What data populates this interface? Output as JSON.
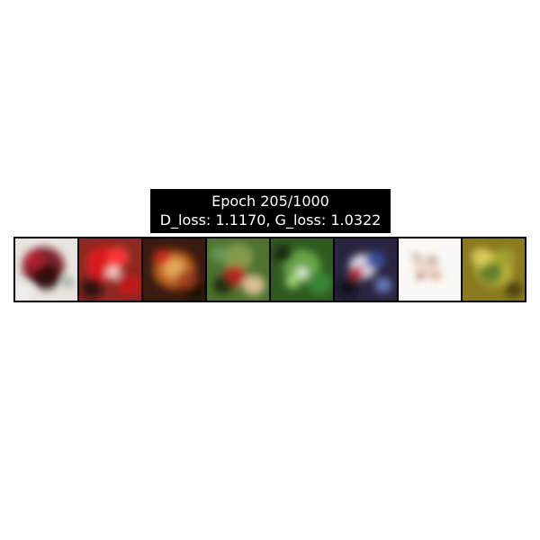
{
  "figure": {
    "title_line1": "Epoch 205/1000",
    "title_line2": "D_loss: 1.1170, G_loss: 1.0322"
  },
  "samples": [
    {
      "name": "sample-1",
      "bg": "#e9e4df",
      "blobs": [
        [
          "#6e0f1a",
          0.45,
          0.45,
          0.34
        ],
        [
          "#2a0a0c",
          0.5,
          0.62,
          0.22
        ],
        [
          "#b21e2e",
          0.3,
          0.35,
          0.16
        ],
        [
          "#f2f2f2",
          0.12,
          0.85,
          0.14
        ],
        [
          "#a0b0a0",
          0.85,
          0.7,
          0.1
        ]
      ]
    },
    {
      "name": "sample-2",
      "bg": "#8b2a22",
      "blobs": [
        [
          "#e0181c",
          0.4,
          0.4,
          0.3
        ],
        [
          "#ff3a3a",
          0.62,
          0.3,
          0.18
        ],
        [
          "#f4d6d0",
          0.55,
          0.55,
          0.12
        ],
        [
          "#2a0808",
          0.2,
          0.8,
          0.18
        ],
        [
          "#c21818",
          0.8,
          0.75,
          0.2
        ]
      ]
    },
    {
      "name": "sample-3",
      "bg": "#3b1a10",
      "blobs": [
        [
          "#c8641e",
          0.5,
          0.5,
          0.34
        ],
        [
          "#e8b060",
          0.5,
          0.48,
          0.18
        ],
        [
          "#d02a1c",
          0.3,
          0.3,
          0.14
        ],
        [
          "#1a0a06",
          0.85,
          0.85,
          0.16
        ],
        [
          "#a04020",
          0.7,
          0.65,
          0.16
        ]
      ]
    },
    {
      "name": "sample-4",
      "bg": "#4f7230",
      "blobs": [
        [
          "#8aa050",
          0.5,
          0.3,
          0.24
        ],
        [
          "#c02020",
          0.45,
          0.6,
          0.18
        ],
        [
          "#e8c8a0",
          0.75,
          0.75,
          0.18
        ],
        [
          "#1c2a12",
          0.25,
          0.75,
          0.16
        ],
        [
          "#6a9a60",
          0.2,
          0.25,
          0.14
        ]
      ]
    },
    {
      "name": "sample-5",
      "bg": "#2f5a1f",
      "blobs": [
        [
          "#6fae4a",
          0.5,
          0.45,
          0.3
        ],
        [
          "#e8f0e0",
          0.5,
          0.55,
          0.1
        ],
        [
          "#142a0c",
          0.2,
          0.25,
          0.16
        ],
        [
          "#3a8a3a",
          0.78,
          0.72,
          0.2
        ],
        [
          "#a0d070",
          0.35,
          0.7,
          0.12
        ]
      ]
    },
    {
      "name": "sample-6",
      "bg": "#2a2440",
      "blobs": [
        [
          "#e8eaf4",
          0.45,
          0.45,
          0.22
        ],
        [
          "#3a50a0",
          0.65,
          0.35,
          0.16
        ],
        [
          "#c02020",
          0.35,
          0.55,
          0.12
        ],
        [
          "#0a0a18",
          0.2,
          0.8,
          0.16
        ],
        [
          "#6a80c0",
          0.78,
          0.75,
          0.14
        ]
      ]
    },
    {
      "name": "sample-7",
      "bg": "#fbf8f6",
      "blobs": [
        [
          "#e8d8c8",
          0.45,
          0.45,
          0.2
        ],
        [
          "#b02018",
          0.35,
          0.6,
          0.06
        ],
        [
          "#702010",
          0.55,
          0.35,
          0.05
        ],
        [
          "#d0a080",
          0.6,
          0.6,
          0.08
        ],
        [
          "#7a5040",
          0.28,
          0.3,
          0.05
        ]
      ]
    },
    {
      "name": "sample-8",
      "bg": "#8a7a20",
      "blobs": [
        [
          "#c8c040",
          0.5,
          0.5,
          0.3
        ],
        [
          "#5a7a2a",
          0.45,
          0.55,
          0.2
        ],
        [
          "#e0d060",
          0.3,
          0.3,
          0.16
        ],
        [
          "#4a3a10",
          0.82,
          0.82,
          0.14
        ],
        [
          "#a0a030",
          0.7,
          0.3,
          0.16
        ]
      ]
    }
  ]
}
